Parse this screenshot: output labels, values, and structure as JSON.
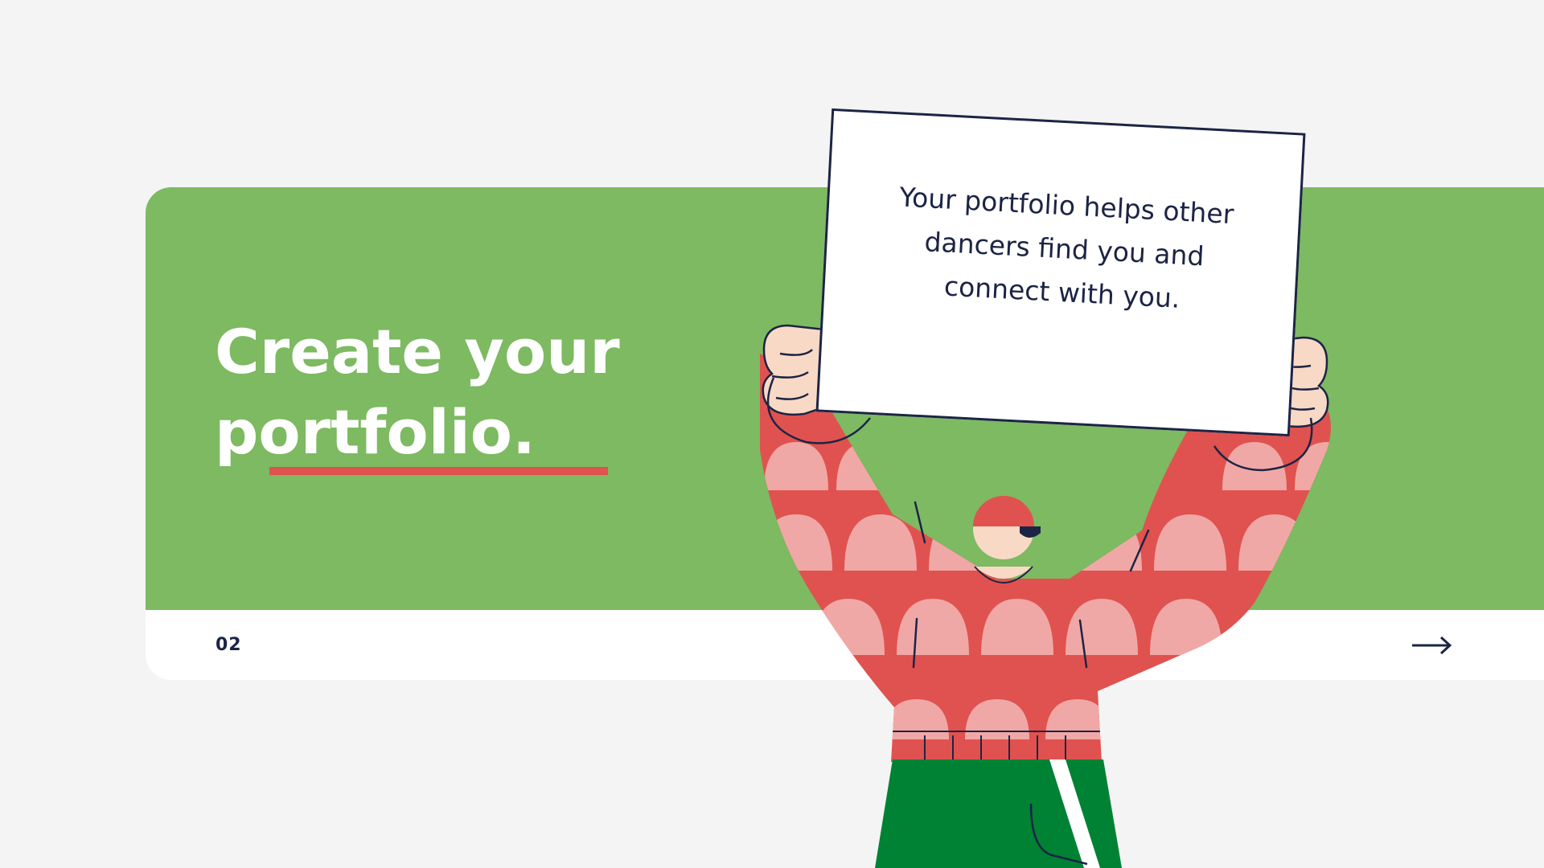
{
  "slide": {
    "title_line1": "Create your",
    "title_line2": "portfolio.",
    "sign_text": "Your portfolio helps other dancers find you and connect with you.",
    "page_number": "02",
    "next_icon": "arrow-right-icon"
  },
  "colors": {
    "background": "#f4f4f4",
    "green_panel": "#7dba61",
    "accent_underline": "#e0524f",
    "sweater_red": "#e0524f",
    "sweater_pink": "#f0a8a6",
    "pants_green": "#008234",
    "skin": "#f8d9c6",
    "ink": "#1c2445"
  }
}
